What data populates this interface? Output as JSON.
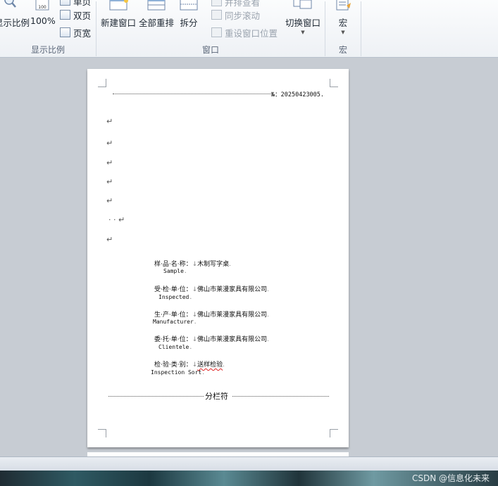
{
  "ribbon": {
    "zoom_group": {
      "label": "显示比例",
      "zoom_button": "显示比例",
      "pct_button": "100%",
      "one_page": "单页",
      "two_pages": "双页",
      "page_width": "页宽"
    },
    "window_group": {
      "label": "窗口",
      "new_window": "新建窗口",
      "arrange_all": "全部重排",
      "split": "拆分",
      "view_side_by_side": "并排查看",
      "sync_scroll": "同步滚动",
      "reset_window_pos": "重设窗口位置",
      "switch_window": "切换窗口"
    },
    "macro_group": {
      "label": "宏",
      "macro_button": "宏"
    }
  },
  "document": {
    "number_line": "№：20250423005.",
    "paragraph_mark": "↵",
    "fields": [
      {
        "cn": "样·品·名·称：",
        "value": "木制写字桌",
        "en": "Sample"
      },
      {
        "cn": "受·检·单·位：",
        "value": "佛山市莱漫家具有限公司",
        "en": "Inspected"
      },
      {
        "cn": "生·产·单·位：",
        "value": "佛山市莱漫家具有限公司",
        "en": "Manufacturer"
      },
      {
        "cn": "委·托·单·位：",
        "value": "佛山市莱漫家具有限公司",
        "en": "Clientele"
      },
      {
        "cn": "检·验·类·别：",
        "value": "送样检验",
        "en": "Inspection Sort"
      }
    ],
    "column_break": "分栏符"
  },
  "watermark": "CSDN @信息化未来"
}
